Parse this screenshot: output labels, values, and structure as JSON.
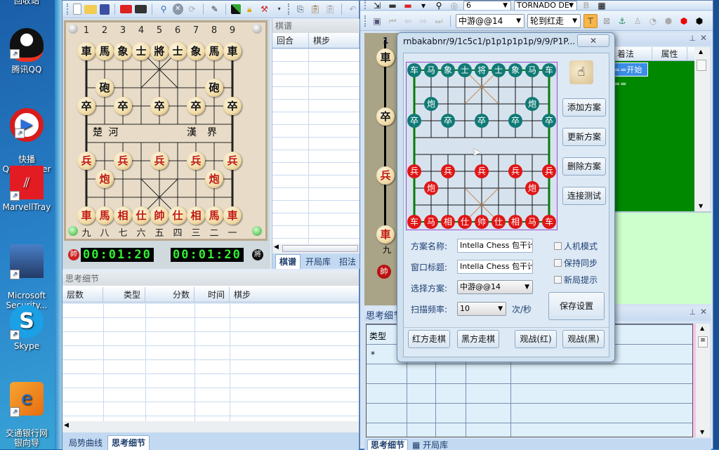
{
  "desktop": {
    "icons": [
      {
        "label": "回收站",
        "icon": "recycle-bin-icon"
      },
      {
        "label": "腾讯QQ",
        "icon": "qq-penguin-icon"
      },
      {
        "label": "快播\nQvodPlayer",
        "icon": "qvod-player-icon"
      },
      {
        "label": "MarvellTray",
        "icon": "marvell-tray-icon"
      },
      {
        "label": "Microsoft\nSecurity...",
        "icon": "microsoft-security-icon"
      },
      {
        "label": "Skype",
        "icon": "skype-icon"
      },
      {
        "label": "交通银行网\n银向导",
        "icon": "bank-guide-icon"
      }
    ]
  },
  "left_app": {
    "toolbar": [
      "new-file-icon",
      "open-folder-icon",
      "save-icon",
      "red-computer-icon",
      "black-computer-icon",
      "search-icon",
      "stop-icon",
      "refresh-icon",
      "edit-icon",
      "flip-board-icon",
      "lock-icon",
      "hammer-icon",
      "more-icon",
      "copy-icon",
      "paste-icon",
      "paste-special-icon",
      "undo-icon"
    ],
    "board": {
      "top_files": [
        "1",
        "2",
        "3",
        "4",
        "5",
        "6",
        "7",
        "8",
        "9"
      ],
      "bottom_files": [
        "九",
        "八",
        "七",
        "六",
        "五",
        "四",
        "三",
        "二",
        "一"
      ],
      "river_left": "楚  河",
      "river_right": "漢  界",
      "black_back": [
        "車",
        "馬",
        "象",
        "士",
        "將",
        "士",
        "象",
        "馬",
        "車"
      ],
      "black_cannon": "砲",
      "black_pawn": "卒",
      "red_back": [
        "車",
        "馬",
        "相",
        "仕",
        "帥",
        "仕",
        "相",
        "馬",
        "車"
      ],
      "red_cannon": "炮",
      "red_pawn": "兵"
    },
    "clocks": {
      "red_badge": "帥",
      "red_time": "00:01:20",
      "black_badge": "將",
      "black_time": "00:01:20"
    },
    "record_panel": {
      "title": "棋谱",
      "columns": [
        "回合",
        "棋步"
      ],
      "tabs": [
        "棋谱",
        "开局库",
        "招法"
      ],
      "active_tab": "棋谱"
    },
    "thinking_panel": {
      "title": "思考细节",
      "columns": [
        "层数",
        "类型",
        "分数",
        "时间",
        "棋步"
      ],
      "tabs": [
        "局势曲线",
        "思考细节"
      ],
      "active_tab": "思考细节"
    }
  },
  "right_app": {
    "toolbar1": {
      "depth_value": "6",
      "engine_value": "TORNADO DE"
    },
    "toolbar2": {
      "scheme_value": "中游@@14",
      "turn_value": "轮到红走"
    },
    "moves_panel": {
      "columns": [
        "着法",
        "属性"
      ],
      "first_row": "==开始=="
    },
    "thinking_panel": {
      "title": "思考细节",
      "columns": [
        "类型"
      ],
      "first_row": "*",
      "tabs": [
        "思考细节",
        "开局库"
      ]
    },
    "partial_board": {
      "top_file": "1",
      "bottom_file": "九",
      "pieces": [
        "車",
        "卒",
        "兵",
        "車"
      ],
      "badge": "帥"
    }
  },
  "dialog": {
    "title": "rnbakabnr/9/1c5c1/p1p1p1p1p/9/9/P1P...",
    "board": {
      "top_back": [
        "车",
        "马",
        "象",
        "士",
        "将",
        "士",
        "象",
        "马",
        "车"
      ],
      "top_cannon": "炮",
      "top_pawn": "卒",
      "bottom_back": [
        "车",
        "马",
        "相",
        "仕",
        "帅",
        "仕",
        "相",
        "马",
        "车"
      ],
      "bottom_cannon": "炮",
      "bottom_pawn": "兵"
    },
    "buttons": {
      "add": "添加方案",
      "update": "更新方案",
      "delete": "删除方案",
      "test": "连接测试",
      "save": "保存设置",
      "red_move": "红方走棋",
      "black_move": "黑方走棋",
      "watch_red": "观战(红)",
      "watch_black": "观战(黑)"
    },
    "fields": {
      "scheme_name_label": "方案名称:",
      "scheme_name_value": "Intella Chess 包干计",
      "window_title_label": "窗口标题:",
      "window_title_value": "Intella Chess 包干计",
      "select_scheme_label": "选择方案:",
      "select_scheme_value": "中游@@14",
      "scan_rate_label": "扫描频率:",
      "scan_rate_value": "10",
      "scan_rate_unit": "次/秒"
    },
    "checkboxes": [
      {
        "label": "人机模式",
        "checked": false
      },
      {
        "label": "保持同步",
        "checked": false
      },
      {
        "label": "新局提示",
        "checked": false
      }
    ]
  },
  "colors": {
    "board_teal": "#0f7a75",
    "board_red": "#e01616",
    "moves_green": "#008800",
    "accent_blue": "#3a8ee6"
  }
}
